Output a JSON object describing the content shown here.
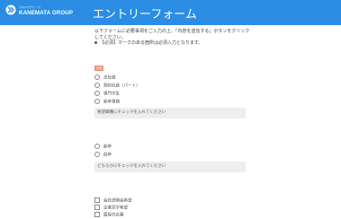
{
  "header": {
    "logo_text": "KANEMATA GROUP",
    "logo_sub": "カネマタグループ",
    "title": "エントリーフォーム",
    "bg_color": "#2a8de3"
  },
  "intro": {
    "text": "以下フォームに必要事項をご入力の上、「内容を送信する」ボタンをクリックしてください。",
    "note": "【必須】マークのある箇所は必須入力となります。"
  },
  "employment": {
    "required_label": "必須",
    "options": [
      {
        "label": "正社員",
        "checked": false
      },
      {
        "label": "契約社員（パート）",
        "checked": false
      },
      {
        "label": "専門学生",
        "checked": false
      },
      {
        "label": "新卒事務",
        "checked": false
      }
    ],
    "hint": "希望職種にチェックを入れてください"
  },
  "type": {
    "options": [
      {
        "label": "新卒",
        "checked": false
      },
      {
        "label": "既卒",
        "checked": false
      }
    ],
    "hint": "どちらかにチェックを入れてください"
  },
  "source": {
    "options": [
      {
        "label": "会社説明会希望",
        "checked": false
      },
      {
        "label": "企業見学希望",
        "checked": false
      },
      {
        "label": "面接の応募",
        "checked": false
      }
    ]
  },
  "colors": {
    "accent": "#2a8de3",
    "required": "#f0896a",
    "hint_bg": "#eeeeee"
  }
}
